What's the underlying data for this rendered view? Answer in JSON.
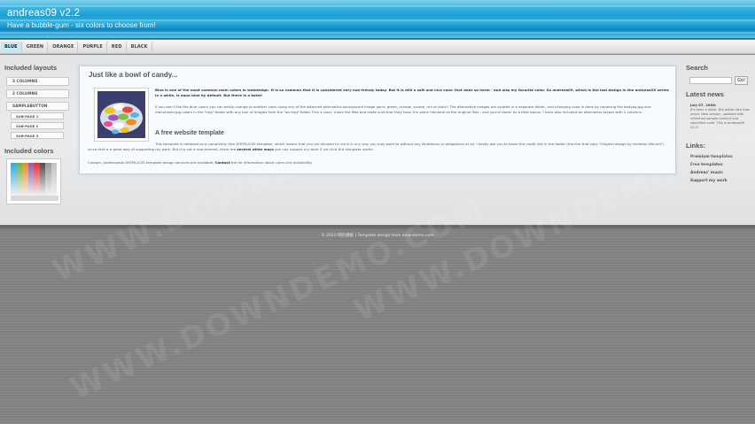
{
  "header": {
    "title": "andreas09 v2.2",
    "tagline": "Have a bubble-gum - six colors to choose from!"
  },
  "nav": {
    "items": [
      "BLUE",
      "GREEN",
      "ORANGE",
      "PURPLE",
      "RED",
      "BLACK"
    ],
    "active": "BLUE"
  },
  "left_sidebar": {
    "layouts_heading": "Included layouts",
    "layout_links": [
      "3 COLUMNS",
      "2 COLUMNS",
      "SAMPLEBUTTON"
    ],
    "sub_pages": [
      "SUB-PAGE 1",
      "SUB-PAGE 2",
      "SUB-PAGE 3"
    ],
    "colors_heading": "Included colors",
    "swatches": [
      "#3aa7d6",
      "#6cb33f",
      "#ee8a1c",
      "#8e5aa8",
      "#d8323d",
      "#4a4a4a",
      "#9a9a9a",
      "#c0c0c0"
    ]
  },
  "main": {
    "title": "Just like a bowl of candy...",
    "intro": "Blue is one of the most common main colors in webdesign. It is so common that it is considered very non-trendy today. But it is still a soft and nice color that does so harm - and also my favorite color. So andreas09, which is the last design in the andreasXX series in a while, is aqua blue by default. But there is a twist!",
    "para2": "If you don't like the blue colors you can easily change to another color using any of the attached alternative background image pairs: green, orange, purple, red or black! The alternative images are located in a separate folder, and changing color is done by replacing the bodybg.jpg and menuhover.jpg colors in the \"img\" folder with any pair of images from the \"alt-img\" folder. Pick a color, move the files and make sure that they have the same filename as the original files - and you're done! As a little bonus, I have also included an alternative layout with 2 columns.",
    "subtitle": "A free website template",
    "para3_a": "This template is released as a completely free XHTML/CSS template, which means that you are allowed to use it in any way you may want to without any limitations or obligations at all. I kindly ask you to leave the credit link in the footer (the line that says \"Original design by Andreas Viklund\") since that is a great way of supporting my work. But it is not a requirement, there are",
    "para3_bold": "several other ways",
    "para3_b": "you can support my work if you find this template useful.",
    "para4_a": "Custom, professional XHTML/CSS template design services are available.",
    "para4_bold": "Contact",
    "para4_b": "me for information about rates and availability."
  },
  "right_sidebar": {
    "search_heading": "Search",
    "search_value": "",
    "search_button": "Go!",
    "news_heading": "Latest news",
    "news_date": "July 07, 2008:",
    "news_text": "It's been a while. But better late than never. New version, updated with refreshed sample content and simplified code. This is andreas09 v2.2!",
    "links_heading": "Links:",
    "links": [
      "Premium templates",
      "Free templates",
      "Andreas' music",
      "Support my work"
    ]
  },
  "footer": {
    "text": "© 2010 网页模板 | Template design from downdemo.com"
  },
  "watermark": {
    "lines": [
      "WWW.DOWNDEMO.COM",
      "WWW.DOWNDEMO.COM",
      "WWW.DOWNDEMO.COM"
    ]
  }
}
